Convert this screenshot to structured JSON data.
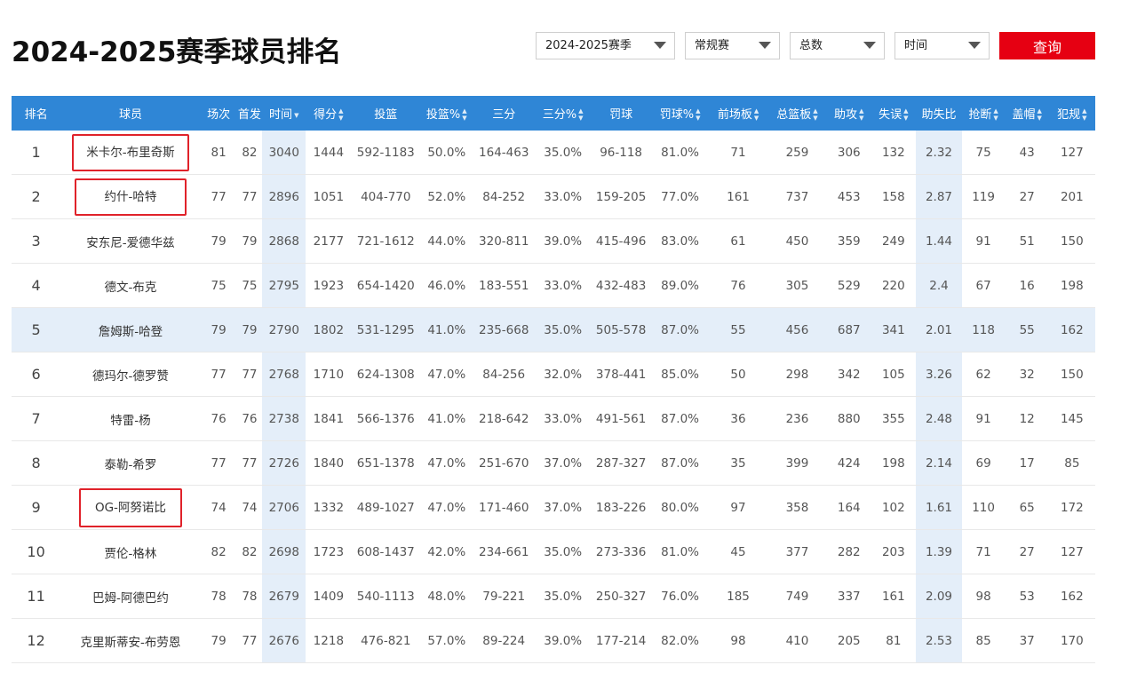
{
  "title": "2024-2025赛季球员排名",
  "filters": {
    "season": "2024-2025赛季",
    "type": "常规赛",
    "stat": "总数",
    "sort": "时间"
  },
  "query_label": "查询",
  "columns": [
    "排名",
    "球员",
    "场次",
    "首发",
    "时间",
    "得分",
    "投篮",
    "投篮%",
    "三分",
    "三分%",
    "罚球",
    "罚球%",
    "前场板",
    "总篮板",
    "助攻",
    "失误",
    "助失比",
    "抢断",
    "盖帽",
    "犯规"
  ],
  "rows": [
    [
      "1",
      "米卡尔-布里奇斯",
      "81",
      "82",
      "3040",
      "1444",
      "592-1183",
      "50.0%",
      "164-463",
      "35.0%",
      "96-118",
      "81.0%",
      "71",
      "259",
      "306",
      "132",
      "2.32",
      "75",
      "43",
      "127"
    ],
    [
      "2",
      "约什-哈特",
      "77",
      "77",
      "2896",
      "1051",
      "404-770",
      "52.0%",
      "84-252",
      "33.0%",
      "159-205",
      "77.0%",
      "161",
      "737",
      "453",
      "158",
      "2.87",
      "119",
      "27",
      "201"
    ],
    [
      "3",
      "安东尼-爱德华兹",
      "79",
      "79",
      "2868",
      "2177",
      "721-1612",
      "44.0%",
      "320-811",
      "39.0%",
      "415-496",
      "83.0%",
      "61",
      "450",
      "359",
      "249",
      "1.44",
      "91",
      "51",
      "150"
    ],
    [
      "4",
      "德文-布克",
      "75",
      "75",
      "2795",
      "1923",
      "654-1420",
      "46.0%",
      "183-551",
      "33.0%",
      "432-483",
      "89.0%",
      "76",
      "305",
      "529",
      "220",
      "2.4",
      "67",
      "16",
      "198"
    ],
    [
      "5",
      "詹姆斯-哈登",
      "79",
      "79",
      "2790",
      "1802",
      "531-1295",
      "41.0%",
      "235-668",
      "35.0%",
      "505-578",
      "87.0%",
      "55",
      "456",
      "687",
      "341",
      "2.01",
      "118",
      "55",
      "162"
    ],
    [
      "6",
      "德玛尔-德罗赞",
      "77",
      "77",
      "2768",
      "1710",
      "624-1308",
      "47.0%",
      "84-256",
      "32.0%",
      "378-441",
      "85.0%",
      "50",
      "298",
      "342",
      "105",
      "3.26",
      "62",
      "32",
      "150"
    ],
    [
      "7",
      "特雷-杨",
      "76",
      "76",
      "2738",
      "1841",
      "566-1376",
      "41.0%",
      "218-642",
      "33.0%",
      "491-561",
      "87.0%",
      "36",
      "236",
      "880",
      "355",
      "2.48",
      "91",
      "12",
      "145"
    ],
    [
      "8",
      "泰勒-希罗",
      "77",
      "77",
      "2726",
      "1840",
      "651-1378",
      "47.0%",
      "251-670",
      "37.0%",
      "287-327",
      "87.0%",
      "35",
      "399",
      "424",
      "198",
      "2.14",
      "69",
      "17",
      "85"
    ],
    [
      "9",
      "OG-阿努诺比",
      "74",
      "74",
      "2706",
      "1332",
      "489-1027",
      "47.0%",
      "171-460",
      "37.0%",
      "183-226",
      "80.0%",
      "97",
      "358",
      "164",
      "102",
      "1.61",
      "110",
      "65",
      "172"
    ],
    [
      "10",
      "贾伦-格林",
      "82",
      "82",
      "2698",
      "1723",
      "608-1437",
      "42.0%",
      "234-661",
      "35.0%",
      "273-336",
      "81.0%",
      "45",
      "377",
      "282",
      "203",
      "1.39",
      "71",
      "27",
      "127"
    ],
    [
      "11",
      "巴姆-阿德巴约",
      "78",
      "78",
      "2679",
      "1409",
      "540-1113",
      "48.0%",
      "79-221",
      "35.0%",
      "250-327",
      "76.0%",
      "185",
      "749",
      "337",
      "161",
      "2.09",
      "98",
      "53",
      "162"
    ],
    [
      "12",
      "克里斯蒂安-布劳恩",
      "79",
      "77",
      "2676",
      "1218",
      "476-821",
      "57.0%",
      "89-224",
      "39.0%",
      "177-214",
      "82.0%",
      "98",
      "410",
      "205",
      "81",
      "2.53",
      "85",
      "37",
      "170"
    ]
  ]
}
